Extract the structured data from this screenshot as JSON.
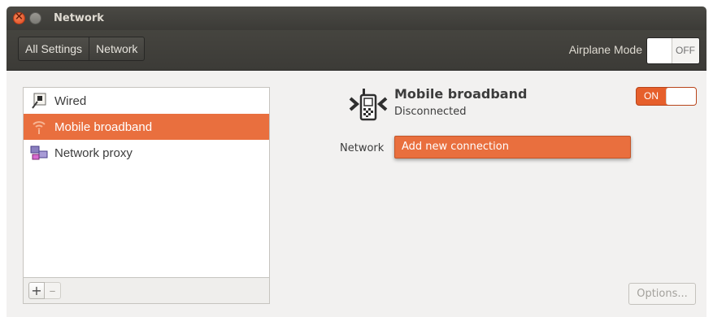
{
  "window": {
    "title": "Network",
    "controls": [
      "close-icon",
      "minimize-icon"
    ]
  },
  "toolbar": {
    "breadcrumbs": [
      "All Settings",
      "Network"
    ],
    "airplane_label": "Airplane Mode",
    "airplane_state": "OFF"
  },
  "sidebar": {
    "items": [
      {
        "label": "Wired",
        "icon": "wired-network-icon",
        "selected": false
      },
      {
        "label": "Mobile broadband",
        "icon": "mobile-broadband-signal-icon",
        "selected": true
      },
      {
        "label": "Network proxy",
        "icon": "network-proxy-icon",
        "selected": false
      }
    ],
    "add_label": "+",
    "remove_label": "–"
  },
  "device": {
    "name": "Mobile broadband",
    "status": "Disconnected",
    "icon": "mobile-broadband-device-icon",
    "switch_state": "ON"
  },
  "network": {
    "label": "Network",
    "dropdown_option": "Add new connection"
  },
  "options_label": "Options...",
  "colors": {
    "accent": "#e96f3e",
    "titlebar": "#3c3b37",
    "background": "#f2f1f0"
  }
}
